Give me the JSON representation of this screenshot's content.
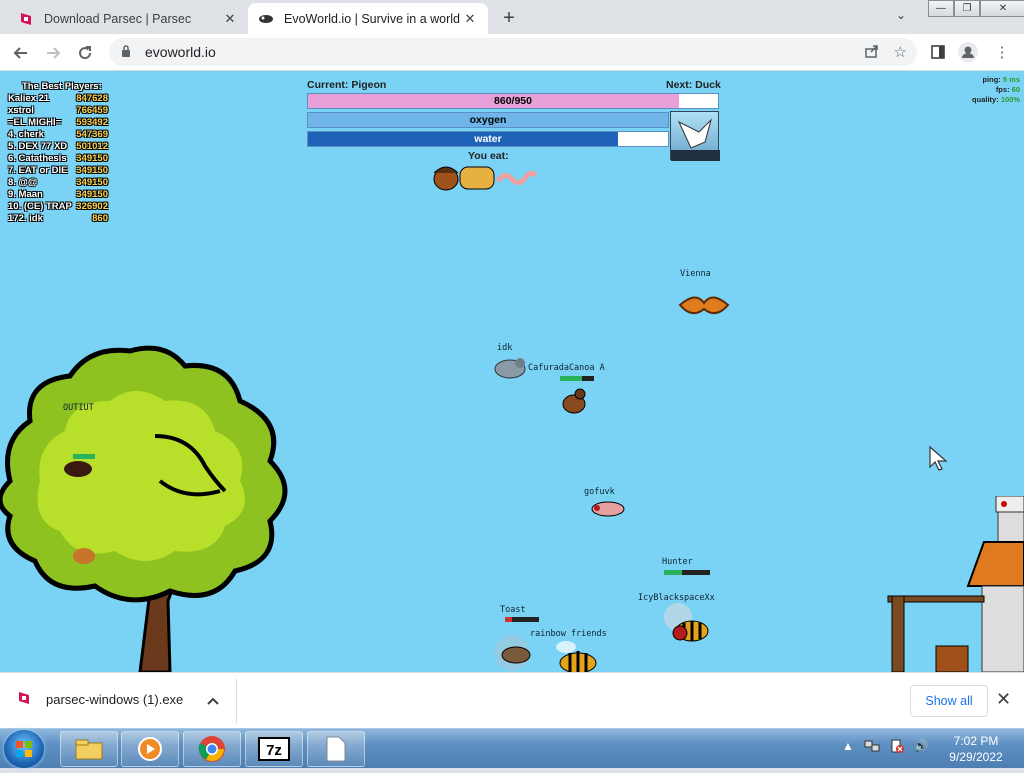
{
  "tabs": [
    {
      "title": "Download Parsec | Parsec",
      "active": false
    },
    {
      "title": "EvoWorld.io | Survive in a world f",
      "active": true
    }
  ],
  "window_controls": {
    "minimize": "—",
    "maximize": "❐",
    "close": "✕"
  },
  "address": {
    "url": "evoworld.io"
  },
  "hud": {
    "current": "Current: Pigeon",
    "next": "Next: Duck",
    "xp": {
      "text": "860/950",
      "fraction": 0.905,
      "color": "#e8a0d8"
    },
    "oxygen": {
      "text": "oxygen",
      "fraction": 1.0,
      "color": "#6fb4ea"
    },
    "water": {
      "text": "water",
      "fraction": 0.86,
      "color": "#1f63b8"
    },
    "you_eat": "You eat:"
  },
  "leaderboard": {
    "title": "The Best Players:",
    "rows": [
      {
        "name": "Kaliex 21",
        "score": "847628"
      },
      {
        "name": "xstrol",
        "score": "766459"
      },
      {
        "name": "=EL MIGHI=",
        "score": "593492"
      },
      {
        "name": "4. cherk",
        "score": "547369"
      },
      {
        "name": "5. DEX 77 XD",
        "score": "501012"
      },
      {
        "name": "6. Catathesis",
        "score": "349150"
      },
      {
        "name": "7. EAT or DIE",
        "score": "349150"
      },
      {
        "name": "8. @@",
        "score": "349150"
      },
      {
        "name": "9. Maan",
        "score": "349150"
      },
      {
        "name": "10. (CE) TRAP",
        "score": "326902"
      },
      {
        "name": "172. idk",
        "score": "860"
      }
    ]
  },
  "stats": {
    "ping_label": "ping:",
    "ping": "5 ms",
    "fps_label": "fps:",
    "fps": "60",
    "quality_label": "quality:",
    "quality": "100%"
  },
  "players": [
    {
      "name": "Vienna"
    },
    {
      "name": "idk"
    },
    {
      "name": "CafuradaCanoa A"
    },
    {
      "name": "OUTIUT"
    },
    {
      "name": "gofuvk"
    },
    {
      "name": "Hunter"
    },
    {
      "name": "IcyBlackspaceXx"
    },
    {
      "name": "Toast"
    },
    {
      "name": "rainbow friends"
    }
  ],
  "download": {
    "filename": "parsec-windows (1).exe",
    "show_all": "Show all"
  },
  "clock": {
    "time": "7:02 PM",
    "date": "9/29/2022"
  }
}
